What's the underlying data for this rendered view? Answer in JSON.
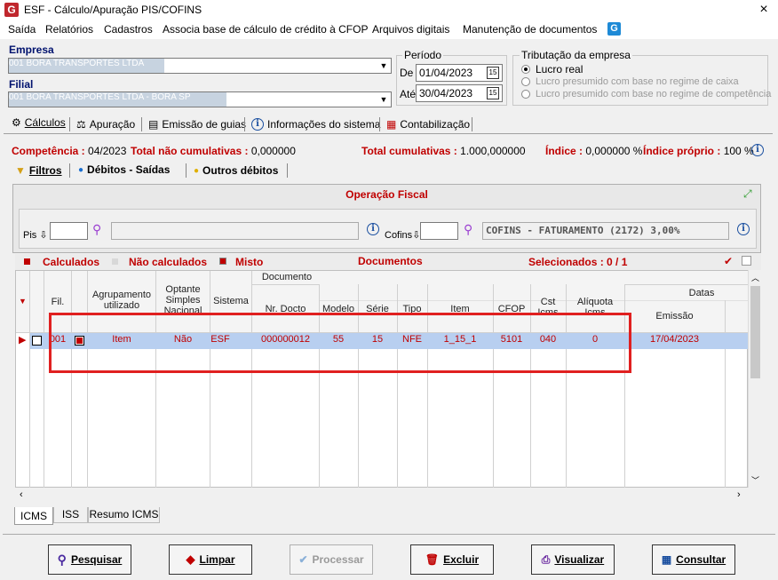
{
  "window": {
    "title": "ESF - Cálculo/Apuração PIS/COFINS",
    "close_glyph": "×"
  },
  "menu": [
    "Saída",
    "Relatórios",
    "Cadastros",
    "Associa base de cálculo de crédito à CFOP",
    "Arquivos digitais",
    "Manutenção de documentos"
  ],
  "empresa": {
    "label": "Empresa",
    "value": "001 BORA TRANSPORTES LTDA"
  },
  "filial": {
    "label": "Filial",
    "value": "001 BORA TRANSPORTES LTDA - BORA SP"
  },
  "periodo": {
    "title": "Período",
    "de_label": "De",
    "de_value": "01/04/2023",
    "ate_label": "Até",
    "ate_value": "30/04/2023"
  },
  "tributacao": {
    "title": "Tributação da empresa",
    "options": [
      "Lucro real",
      "Lucro presumido com base no regime de caixa",
      "Lucro presumido com base no regime de competência"
    ],
    "selected": "Lucro real"
  },
  "main_tabs": [
    "Cálculos",
    "Apuração",
    "Emissão de guias",
    "Informações do sistema",
    "Contabilização"
  ],
  "status": {
    "competencia_label": "Competência :",
    "competencia_value": "04/2023",
    "nao_cum_label": "Total não cumulativas :",
    "nao_cum_value": "0,000000",
    "cum_label": "Total cumulativas :",
    "cum_value": "1.000,000000",
    "indice_label": "Índice :",
    "indice_value": "0,000000 %",
    "indice_proprio_label": "Índice próprio :",
    "indice_proprio_value": "100 %"
  },
  "sub_tabs": [
    "Filtros",
    "Débitos - Saídas",
    "Outros débitos"
  ],
  "operacao": {
    "title": "Operação Fiscal",
    "pis_label": "Pis",
    "cofins_label": "Cofins",
    "cofins_value": "COFINS - FATURAMENTO (2172) 3,00%"
  },
  "legend": {
    "calculados": "Calculados",
    "nao_calculados": "Não calculados",
    "misto": "Misto",
    "documentos": "Documentos",
    "selecionados": "Selecionados : 0 / 1"
  },
  "columns": {
    "documento_group": "Documento",
    "datas_group": "Datas",
    "fil": "Fil.",
    "agrupamento": "Agrupamento utilizado",
    "optante": "Optante Simples Nacional",
    "sistema": "Sistema",
    "nr_docto": "Nr. Docto",
    "modelo": "Modelo",
    "serie": "Série",
    "tipo": "Tipo",
    "item": "Item",
    "cfop": "CFOP",
    "cst": "Cst Icms",
    "aliquota": "Alíquota Icms",
    "emissao": "Emissão"
  },
  "rows": [
    {
      "fil": "001",
      "agrupamento": "Item",
      "optante": "Não",
      "sistema": "ESF",
      "nr_docto": "000000012",
      "modelo": "55",
      "serie": "15",
      "tipo": "NFE",
      "item": "1_15_1",
      "cfop": "5101",
      "cst": "040",
      "aliquota": "0",
      "emissao": "17/04/2023"
    }
  ],
  "bottom_tabs": [
    "ICMS",
    "ISS",
    "Resumo ICMS"
  ],
  "buttons": [
    "Pesquisar",
    "Limpar",
    "Processar",
    "Excluir",
    "Visualizar",
    "Consultar"
  ],
  "colors": {
    "accent_red": "#c00000",
    "label_blue": "#00126e",
    "selection_row": "#b8cff0",
    "highlight_box": "#e02020"
  }
}
